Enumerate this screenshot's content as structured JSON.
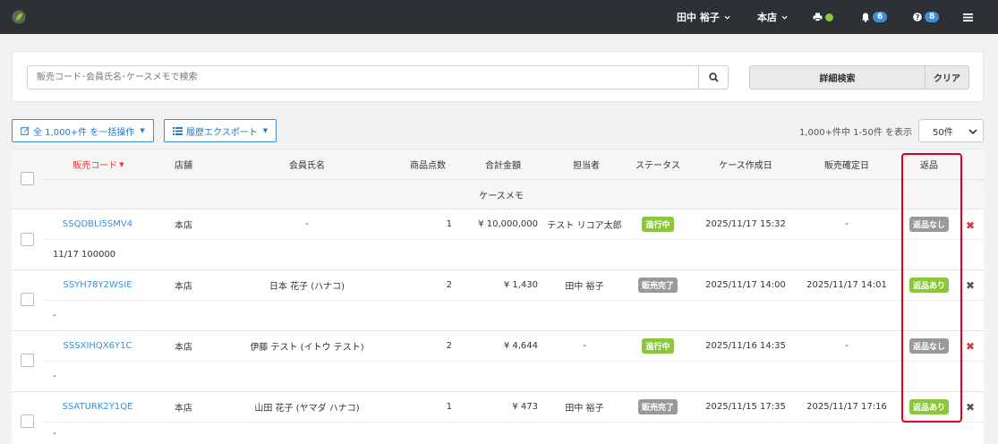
{
  "header": {
    "user_name": "田中 裕子",
    "store": "本店",
    "notification_count": "6",
    "help_count": "8"
  },
  "search": {
    "placeholder": "販売コード･会員氏名･ケースメモで検索",
    "advanced_label": "詳細検索",
    "clear_label": "クリア"
  },
  "toolbar": {
    "bulk_label": "全 1,000+件 を一括操作",
    "export_label": "履歴エクスポート",
    "paging_text": "1,000+件中 1-50件 を表示",
    "per_page": "50件"
  },
  "table": {
    "columns": {
      "code": "販売コード",
      "store": "店舗",
      "member": "会員氏名",
      "items": "商品点数",
      "total": "合計金額",
      "staff": "担当者",
      "status": "ステータス",
      "created": "ケース作成日",
      "confirmed": "販売確定日",
      "returns": "返品",
      "memo": "ケースメモ"
    },
    "rows": [
      {
        "code": "SSQDBLI5SMV4",
        "store": "本店",
        "member": "-",
        "items": "1",
        "total": "¥ 10,000,000",
        "staff": "テスト リコア太郎",
        "status": "進行中",
        "created": "2025/11/17 15:32",
        "confirmed": "-",
        "returns": "返品なし",
        "memo": "11/17 100000"
      },
      {
        "code": "SSYH78Y2WSIE",
        "store": "本店",
        "member": "日本 花子 (ハナコ)",
        "items": "2",
        "total": "¥ 1,430",
        "staff": "田中 裕子",
        "status": "販売完了",
        "created": "2025/11/17 14:00",
        "confirmed": "2025/11/17 14:01",
        "returns": "返品あり",
        "memo": "-"
      },
      {
        "code": "SSSXIHQX6Y1C",
        "store": "本店",
        "member": "伊藤 テスト (イトウ テスト)",
        "items": "2",
        "total": "¥ 4,644",
        "staff": "-",
        "status": "進行中",
        "created": "2025/11/16 14:35",
        "confirmed": "-",
        "returns": "返品なし",
        "memo": "-"
      },
      {
        "code": "SSATURK2Y1QE",
        "store": "本店",
        "member": "山田 花子 (ヤマダ ハナコ)",
        "items": "1",
        "total": "¥ 473",
        "staff": "田中 裕子",
        "status": "販売完了",
        "created": "2025/11/15 17:35",
        "confirmed": "2025/11/17 17:16",
        "returns": "返品あり",
        "memo": "-"
      }
    ]
  },
  "colors": {
    "topbar": "#2d3035",
    "accent": "#3b8fd6",
    "status_green": "#8cc63f",
    "status_gray": "#999999",
    "delete_red": "#e0353b",
    "highlight_red": "#e1001a"
  }
}
